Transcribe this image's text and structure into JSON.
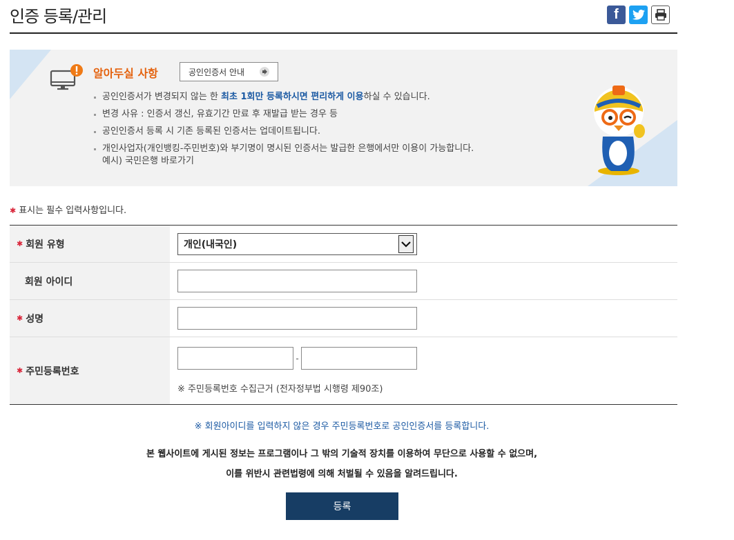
{
  "header": {
    "title": "인증 등록/관리",
    "share": {
      "facebook_glyph": "f",
      "facebook_color": "#3b5998",
      "twitter_color": "#1da1f2"
    }
  },
  "notice": {
    "heading": "알아두실 사항",
    "guide_button": "공인인증서 안내",
    "item1_before": "공인인증서가 변경되지 않는 한 ",
    "item1_highlight": "최초 1회만 등록하시면 편리하게 이용",
    "item1_after": "하실 수 있습니다.",
    "item2": "변경 사유 : 인증서 갱신, 유효기간 만료 후 재발급 받는 경우 등",
    "item3": "공인인증서 등록 시 기존 등록된 인증서는 업데이트됩니다.",
    "item4_line1": "개인사업자(개인뱅킹-주민번호)와 부기명이 명시된 인증서는 발급한 은행에서만 이용이 가능합니다.",
    "item4_line2": "예시) 국민은행 바로가기",
    "accent_color": "#e4620e",
    "highlight_color": "#1c5aa3"
  },
  "required_note": {
    "mark": "✱",
    "text": "표시는 필수 입력사항입니다."
  },
  "form": {
    "member_type": {
      "label": "회원 유형",
      "selected": "개인(내국인)"
    },
    "member_id": {
      "label": "회원 아이디",
      "value": ""
    },
    "name": {
      "label": "성명",
      "value": ""
    },
    "rrn": {
      "label": "주민등록번호",
      "separator": "-",
      "note": "※ 주민등록번호 수집근거 (전자정부법 시행령 제90조)"
    }
  },
  "info": {
    "blue": "※ 회원아이디를 입력하지 않은 경우 주민등록번호로 공인인증서를 등록합니다.",
    "line1": "본 웹사이트에 게시된 정보는 프로그램이나 그 밖의 기술적 장치를 이용하여 무단으로 사용할 수 없으며,",
    "line2": "이를 위반시 관련법령에 의해 처벌될 수 있음을 알려드립니다."
  },
  "submit_button": "등록",
  "colors": {
    "submit_bg": "#173d64",
    "required_mark": "#d9263a"
  }
}
